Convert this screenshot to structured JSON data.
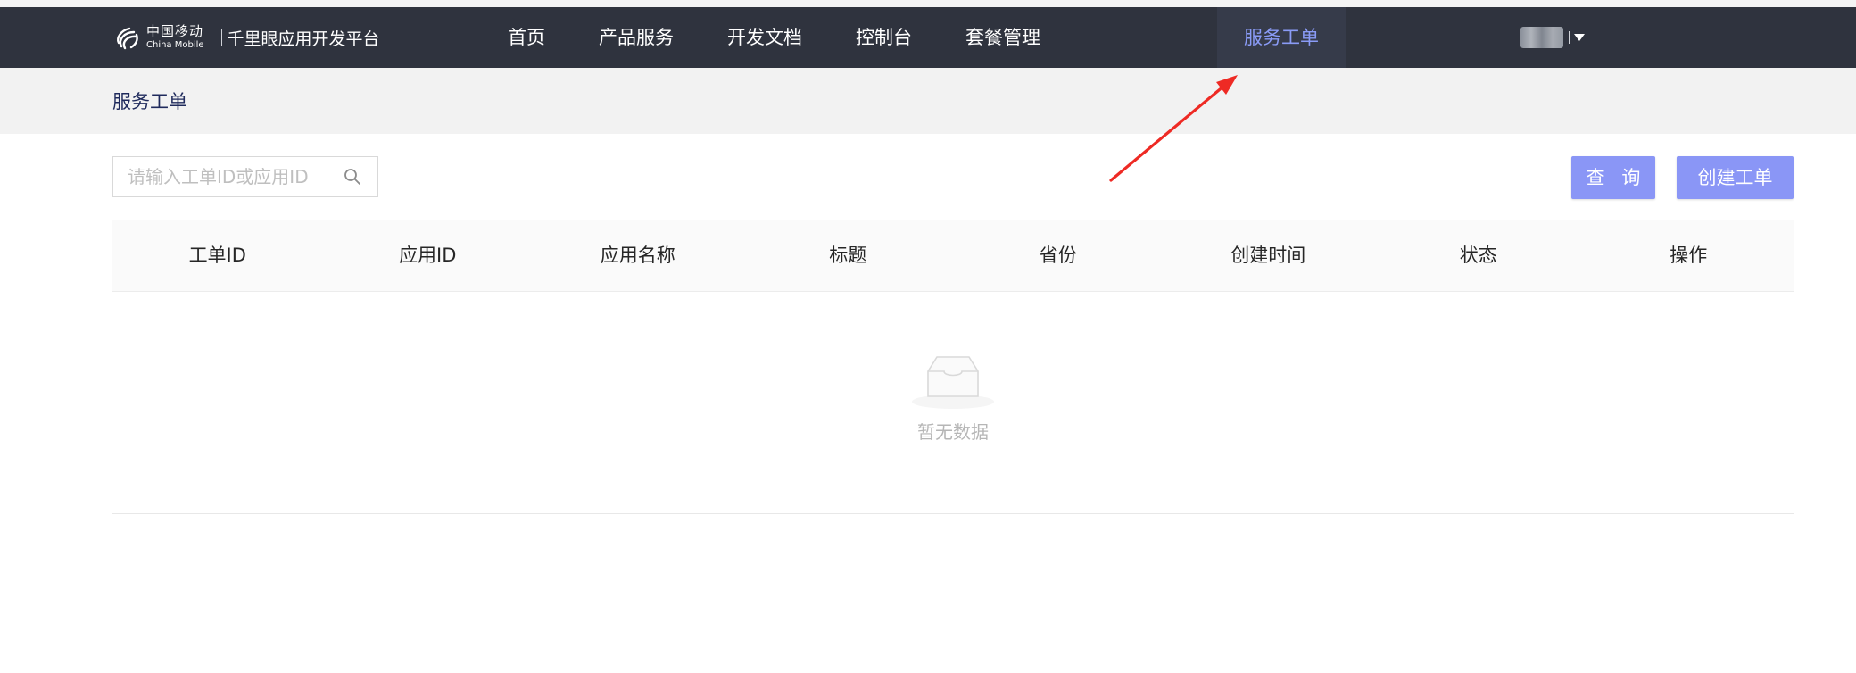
{
  "header": {
    "logo": {
      "cn": "中国移动",
      "en": "China Mobile"
    },
    "platform": "千里眼应用开发平台",
    "nav": [
      {
        "label": "首页"
      },
      {
        "label": "产品服务"
      },
      {
        "label": "开发文档"
      },
      {
        "label": "控制台"
      },
      {
        "label": "套餐管理"
      }
    ],
    "active_nav": "服务工单"
  },
  "breadcrumb": "服务工单",
  "search": {
    "placeholder": "请输入工单ID或应用ID",
    "value": ""
  },
  "buttons": {
    "query": "查 询",
    "create": "创建工单"
  },
  "table": {
    "columns": [
      "工单ID",
      "应用ID",
      "应用名称",
      "标题",
      "省份",
      "创建时间",
      "状态",
      "操作"
    ],
    "rows": [],
    "empty_text": "暂无数据"
  },
  "colors": {
    "header_bg": "#2f333e",
    "active_nav": "#8a9bf6",
    "button": "#8a96f6",
    "annotation_arrow": "#ee2a24"
  }
}
